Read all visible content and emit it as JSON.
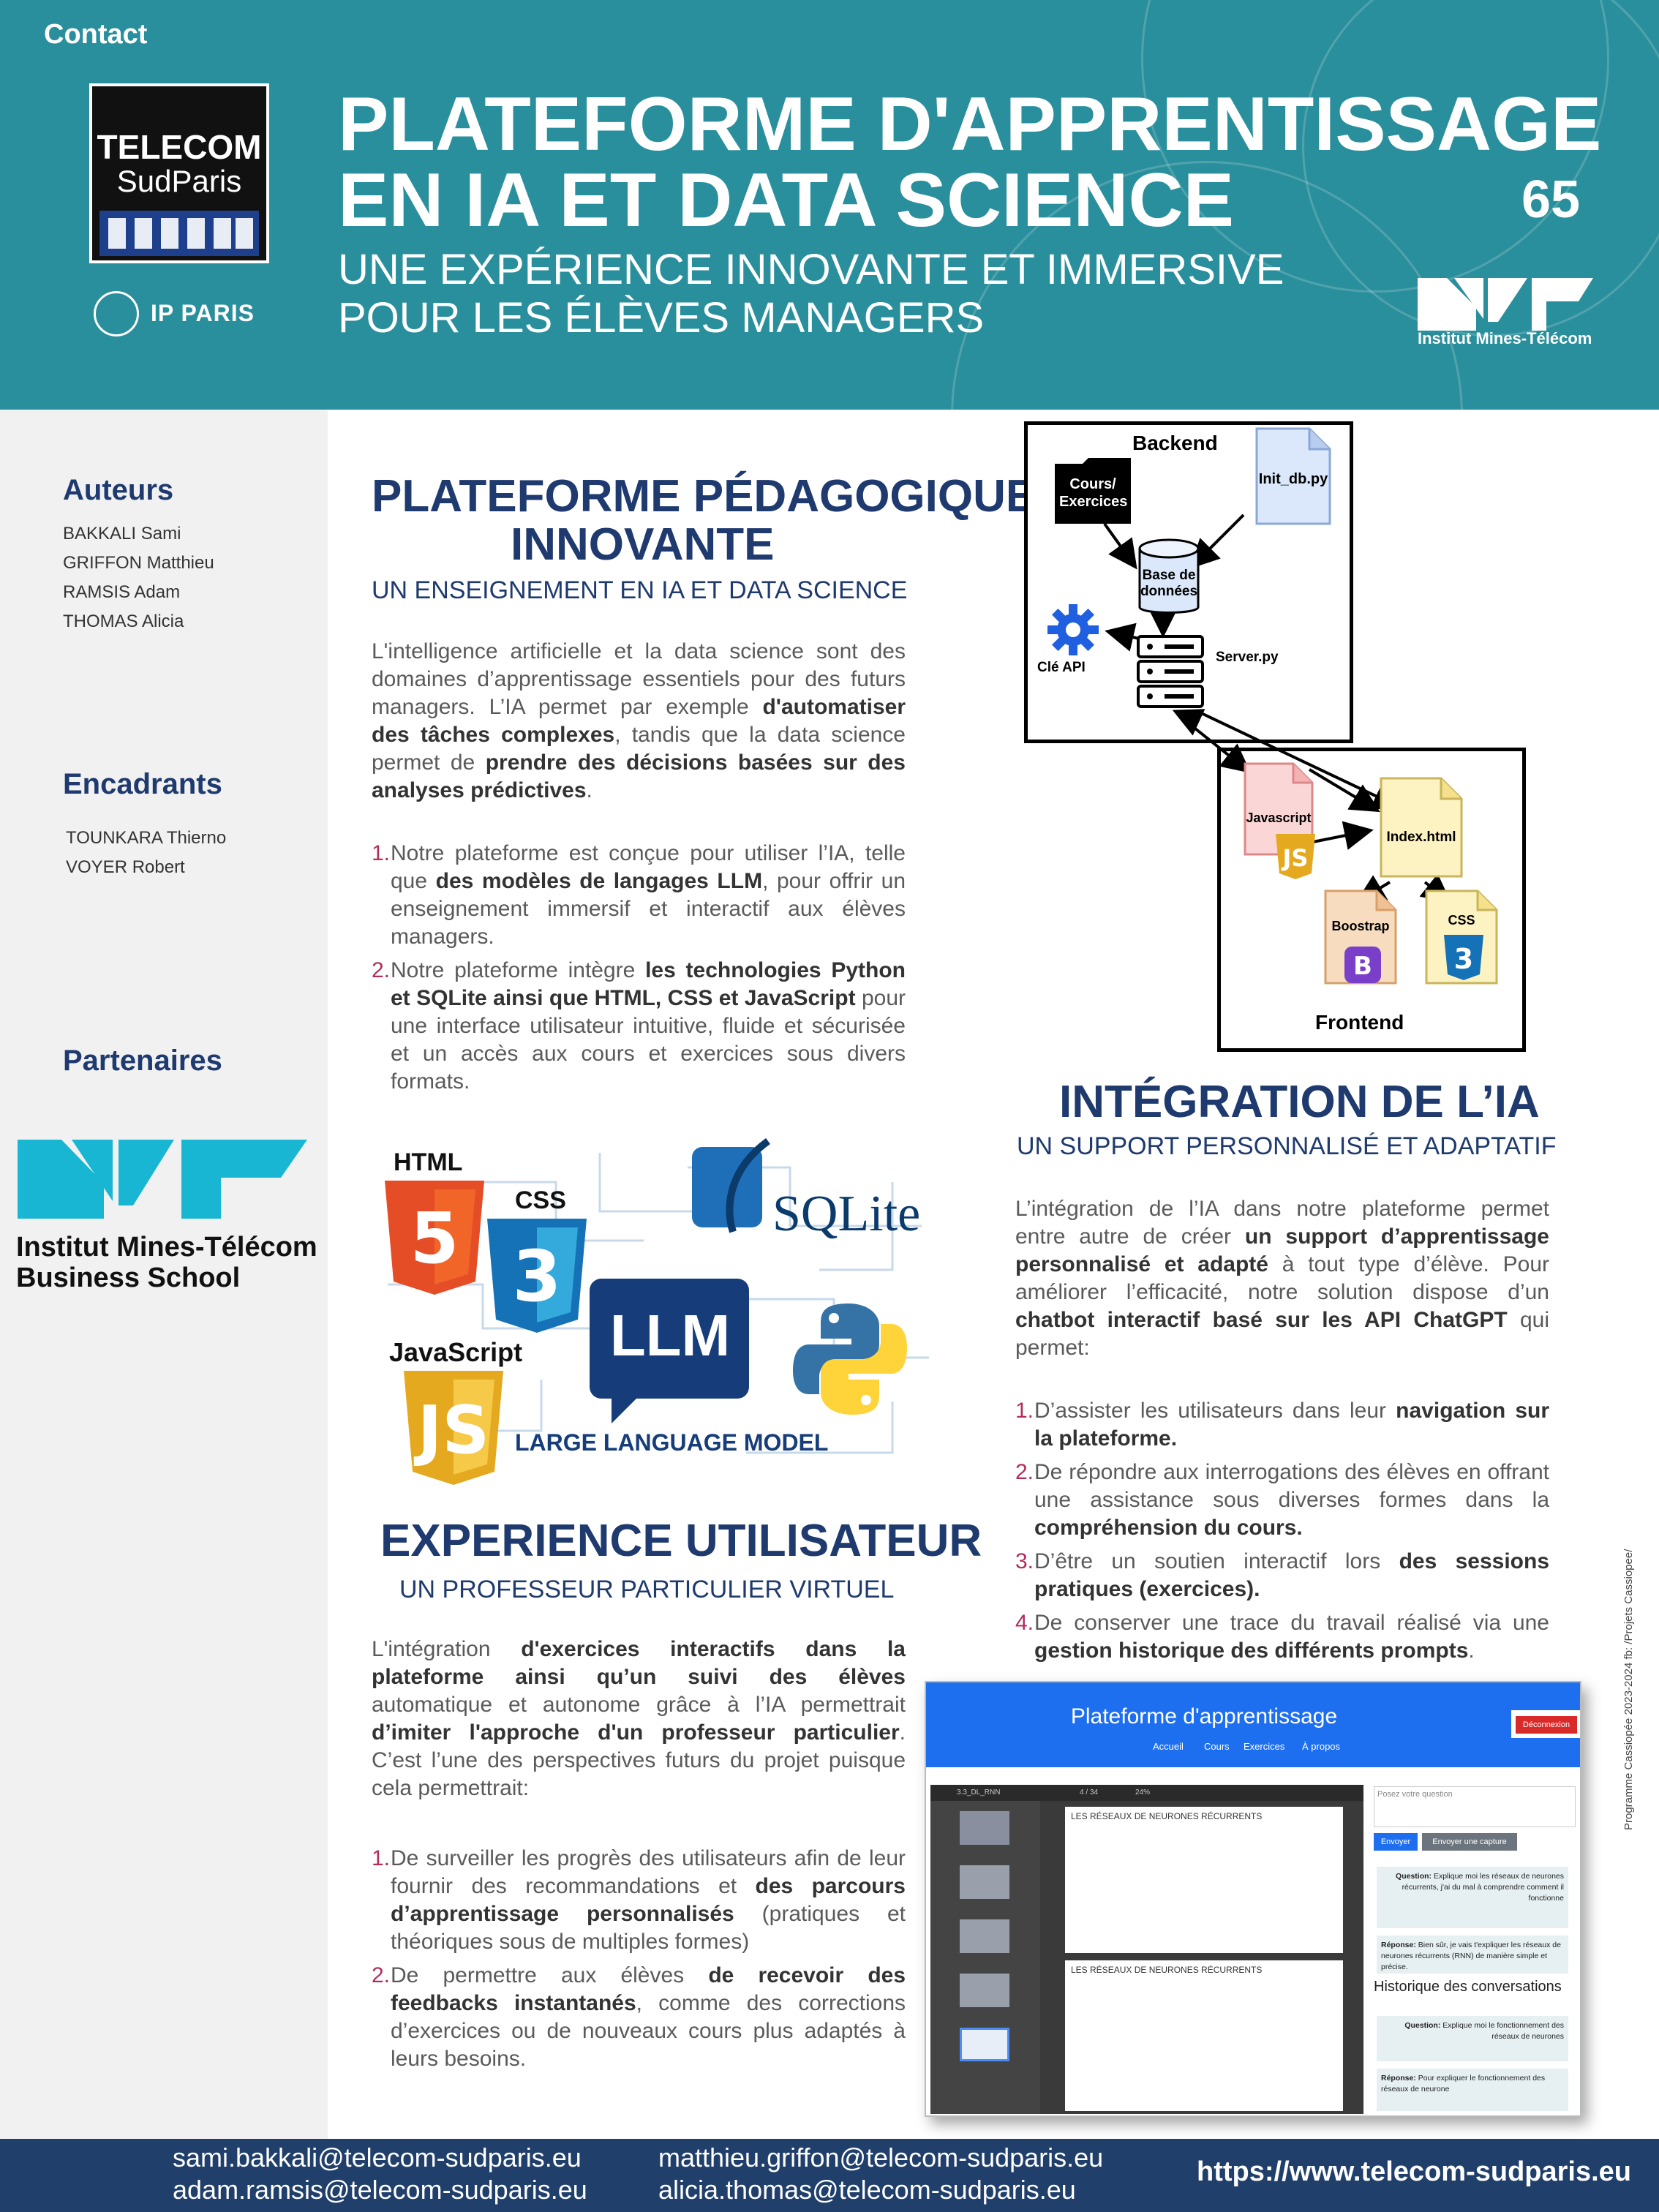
{
  "header": {
    "title_line1": "PLATEFORME D'APPRENTISSAGE",
    "title_line2": "EN IA ET DATA SCIENCE",
    "subtitle_line1": "UNE EXPÉRIENCE INNOVANTE ET IMMERSIVE",
    "subtitle_line2": "POUR LES ÉLÈVES MANAGERS",
    "poster_number": "65",
    "logo_telecom_line1": "TELECOM",
    "logo_telecom_line2": "SudParis",
    "logo_ipparis": "IP PARIS",
    "logo_imt": "Institut Mines-Télécom"
  },
  "sidebar": {
    "authors_heading": "Auteurs",
    "authors": [
      "BAKKALI Sami",
      "GRIFFON Matthieu",
      "RAMSIS Adam",
      "THOMAS Alicia"
    ],
    "supervisors_heading": "Encadrants",
    "supervisors": [
      "TOUNKARA Thierno",
      "VOYER Robert"
    ],
    "partners_heading": "Partenaires",
    "partner_line1": "Institut Mines-Télécom",
    "partner_line2": "Business School"
  },
  "section1": {
    "title_line1": "PLATEFORME PÉDAGOGIQUE",
    "title_line2": "INNOVANTE",
    "subtitle": "UN ENSEIGNEMENT EN IA ET DATA SCIENCE",
    "p1_a": "L'intelligence artificielle et la data science sont des domaines d’apprentissage essentiels pour des futurs managers. L’IA permet par exemple ",
    "p1_b": "d'automatiser des tâches complexes",
    "p1_c": ", tandis que la data science permet de ",
    "p1_d": "prendre des décisions basées sur des analyses prédictives",
    "p1_e": ".",
    "items": [
      {
        "num": "1.",
        "a": "Notre plateforme est conçue pour utiliser l’IA, telle que ",
        "b": "des modèles de langages LLM",
        "c": ", pour offrir un enseignement immersif et interactif aux élèves managers."
      },
      {
        "num": "2.",
        "a": "Notre plateforme intègre ",
        "b": "les technologies Python et SQLite ainsi que HTML, CSS et JavaScript",
        "c": " pour une interface utilisateur intuitive, fluide et sécurisée et un accès aux cours et exercices sous divers formats."
      }
    ]
  },
  "collage": {
    "html": "HTML",
    "css": "CSS",
    "sqlite": "SQLite",
    "llm": "LLM",
    "javascript": "JavaScript",
    "large_language_model": "LARGE LANGUAGE MODEL"
  },
  "section2": {
    "title": "EXPERIENCE UTILISATEUR",
    "subtitle": "UN PROFESSEUR PARTICULIER VIRTUEL",
    "p1_a": "L'intégration ",
    "p1_b": "d'exercices interactifs dans la plateforme ainsi qu’un suivi des élèves",
    "p1_c": " automatique et autonome grâce à l’IA permettrait ",
    "p1_d": "d’imiter l'approche d'un professeur particulier",
    "p1_e": ". C’est l’une des perspectives futurs du projet puisque cela permettrait:",
    "items": [
      {
        "num": "1.",
        "a": "De surveiller les progrès des utilisateurs afin de leur fournir des recommandations et ",
        "b": "des parcours d’apprentissage personnalisés",
        "c": " (pratiques et théoriques sous de multiples formes)"
      },
      {
        "num": "2.",
        "a": "De permettre aux élèves ",
        "b": "de recevoir des feedbacks instantanés",
        "c": ", comme des corrections d’exercices ou de nouveaux cours plus adaptés à leurs besoins."
      }
    ]
  },
  "diagram": {
    "backend": "Backend",
    "frontend": "Frontend",
    "cours_exercices_1": "Cours/",
    "cours_exercices_2": "Exercices",
    "init_db": "Init_db.py",
    "base_donnees_1": "Base de",
    "base_donnees_2": "données",
    "cle_api": "Clé API",
    "server": "Server.py",
    "javascript": "Javascript",
    "index_html": "Index.html",
    "bootstrap": "Boostrap",
    "css": "CSS"
  },
  "section3": {
    "title": "INTÉGRATION DE L’IA",
    "subtitle": "UN SUPPORT PERSONNALISÉ ET ADAPTATIF",
    "p1_a": "L’intégration de l’IA dans notre plateforme permet entre autre de créer ",
    "p1_b": "un support d’apprentissage personnalisé et adapté",
    "p1_c": " à tout type d’élève. Pour améliorer l’efficacité, notre solution dispose d’un ",
    "p1_d": "chatbot interactif basé sur les API ChatGPT",
    "p1_e": " qui permet:",
    "items": [
      {
        "num": "1.",
        "a": "D’assister les utilisateurs dans leur ",
        "b": "navigation sur la plateforme.",
        "c": ""
      },
      {
        "num": "2.",
        "a": "De répondre aux interrogations des élèves en offrant une assistance sous diverses formes dans la ",
        "b": "compréhension du cours.",
        "c": ""
      },
      {
        "num": "3.",
        "a": "D’être un soutien interactif lors ",
        "b": "des sessions pratiques (exercices).",
        "c": ""
      },
      {
        "num": "4.",
        "a": "De conserver une trace du travail réalisé via une ",
        "b": "gestion historique des différents prompts",
        "c": "."
      }
    ]
  },
  "screenshot": {
    "title": "Plateforme d'apprentissage",
    "nav": [
      "Accueil",
      "Cours",
      "Exercices",
      "À propos"
    ],
    "logout": "Déconnexion",
    "pdf_name": "3.3_DL_RNN",
    "pdf_pages": "4 / 34",
    "pdf_zoom": "24%",
    "slide_title": "LES RÉSEAUX DE NEURONES RÉCURRENTS",
    "chat_placeholder": "Posez votre question",
    "send": "Envoyer",
    "send_capture": "Envoyer une capture",
    "question_label": "Question:",
    "question_text": "Explique moi les réseaux de neurones récurrents, j'ai du mal à comprendre comment il fonctionne",
    "answer_label": "Réponse:",
    "answer_text": "Bien sûr, je vais t'expliquer les réseaux de neurones récurrents (RNN) de manière simple et précise.",
    "history_title": "Historique des conversations",
    "history_q": "Explique moi le fonctionnement des réseaux de neurones",
    "history_a": "Pour expliquer le fonctionnement des réseaux de neurone"
  },
  "side_note": "Programme Cassiopée 2023-2024     fb: /Projets Cassiopee/",
  "footer": {
    "contact": "Contact",
    "emails": [
      "sami.bakkali@telecom-sudparis.eu",
      "adam.ramsis@telecom-sudparis.eu",
      "matthieu.griffon@telecom-sudparis.eu",
      "alicia.thomas@telecom-sudparis.eu"
    ],
    "website": "https://www.telecom-sudparis.eu"
  },
  "colors": {
    "header": "#2a8f9c",
    "navy": "#1f3a6e",
    "accent_number": "#b32c5d",
    "footer": "#203f6b"
  }
}
